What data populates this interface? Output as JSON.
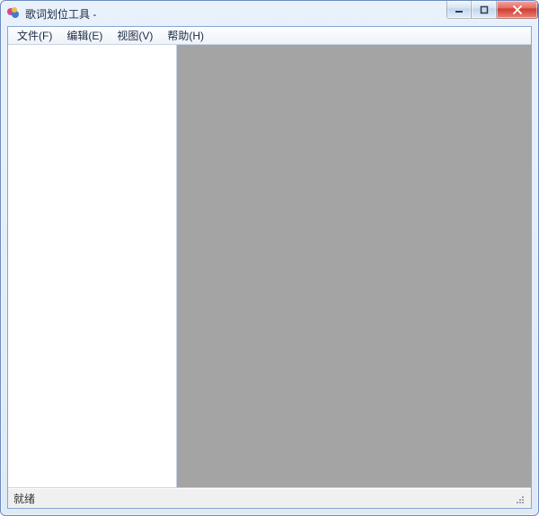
{
  "window": {
    "title": "歌词划位工具 -"
  },
  "menu": {
    "items": [
      {
        "label": "文件(F)"
      },
      {
        "label": "编辑(E)"
      },
      {
        "label": "视图(V)"
      },
      {
        "label": "帮助(H)"
      }
    ]
  },
  "status": {
    "text": "就绪"
  }
}
